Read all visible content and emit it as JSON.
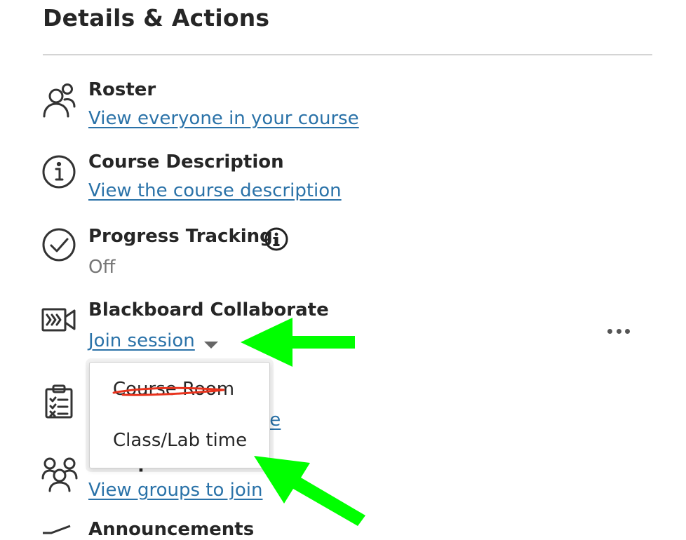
{
  "section": {
    "title": "Details & Actions"
  },
  "roster": {
    "title": "Roster",
    "link": "View everyone in your course",
    "icon": "people-icon"
  },
  "description": {
    "title": "Course Description",
    "link": "View the course description",
    "icon": "info-circle-icon"
  },
  "progress": {
    "title": "Progress Tracking",
    "status": "Off",
    "icon": "check-circle-icon",
    "info_icon": "info-icon"
  },
  "collaborate": {
    "title": "Blackboard Collaborate",
    "link": "Join session",
    "icon": "video-camera-icon",
    "menu_items": [
      "Course Room",
      "Class/Lab time"
    ],
    "more_icon": "more-options-icon"
  },
  "attendance": {
    "link_partial": "ce",
    "icon": "clipboard-icon"
  },
  "groups": {
    "title": "Groups",
    "link": "View groups to join",
    "icon": "group-icon"
  },
  "announcements": {
    "title": "Announcements",
    "icon": "megaphone-icon"
  },
  "annotations": {
    "arrow_color": "#00ff00",
    "strike_color": "#e8321c",
    "struck_item": "Course Room"
  },
  "colors": {
    "link": "#2a72a8",
    "text": "#262626",
    "muted": "#767676"
  }
}
